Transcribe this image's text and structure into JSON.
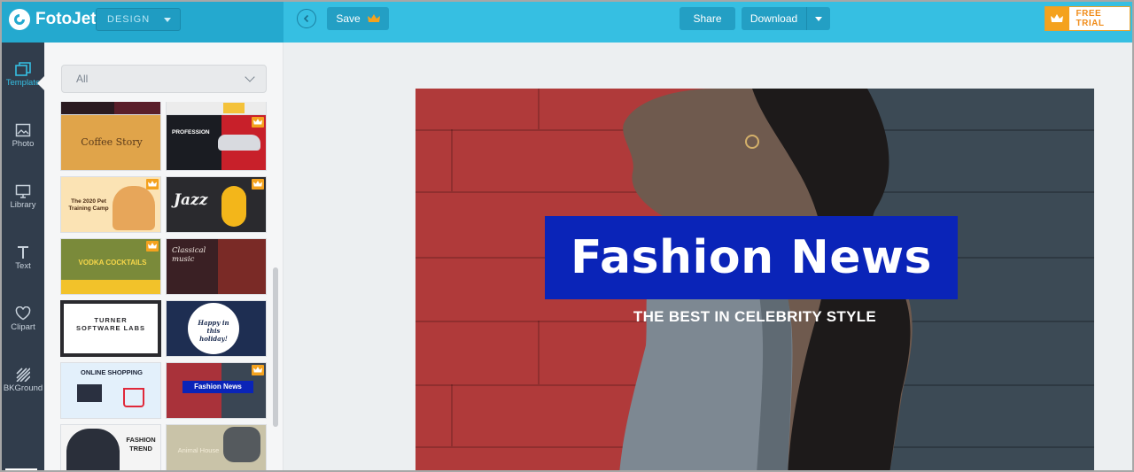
{
  "app": {
    "name": "FotoJet"
  },
  "header": {
    "mode_select": "DESIGN",
    "save_label": "Save",
    "share_label": "Share",
    "download_label": "Download",
    "free_trial_label": "FREE TRIAL"
  },
  "rail": {
    "items": [
      {
        "label": "Template",
        "icon": "template-icon"
      },
      {
        "label": "Photo",
        "icon": "photo-icon"
      },
      {
        "label": "Library",
        "icon": "library-icon"
      },
      {
        "label": "Text",
        "icon": "text-icon"
      },
      {
        "label": "Clipart",
        "icon": "clipart-icon"
      },
      {
        "label": "BKGround",
        "icon": "background-icon"
      }
    ]
  },
  "panel": {
    "filter": "All",
    "templates": [
      {
        "title": "Coffee Story",
        "premium": false
      },
      {
        "title": "PROFESSION",
        "premium": true
      },
      {
        "title": "The 2020 Pet Training Camp",
        "premium": true
      },
      {
        "title": "Jazz",
        "premium": true
      },
      {
        "title": "VODKA COCKTAILS",
        "premium": true
      },
      {
        "title": "Classical music",
        "premium": false
      },
      {
        "title": "TURNER SOFTWARE LABS",
        "premium": false
      },
      {
        "title": "Happy in this holiday!",
        "premium": false
      },
      {
        "title": "ONLINE SHOPPING",
        "premium": false
      },
      {
        "title": "Fashion News",
        "premium": true
      },
      {
        "title": "FASHION TREND",
        "premium": false
      },
      {
        "title": "Animal House",
        "premium": false
      }
    ]
  },
  "canvas": {
    "headline": "Fashion News",
    "subheadline": "THE BEST IN CELEBRITY STYLE",
    "colors": {
      "headline_box": "#0a24b8",
      "left_wall": "#b03a3a",
      "right_wall": "#3c4a55"
    }
  },
  "colors": {
    "brand": "#36bfe2",
    "rail": "#313d4c",
    "premium": "#f4a21e"
  }
}
